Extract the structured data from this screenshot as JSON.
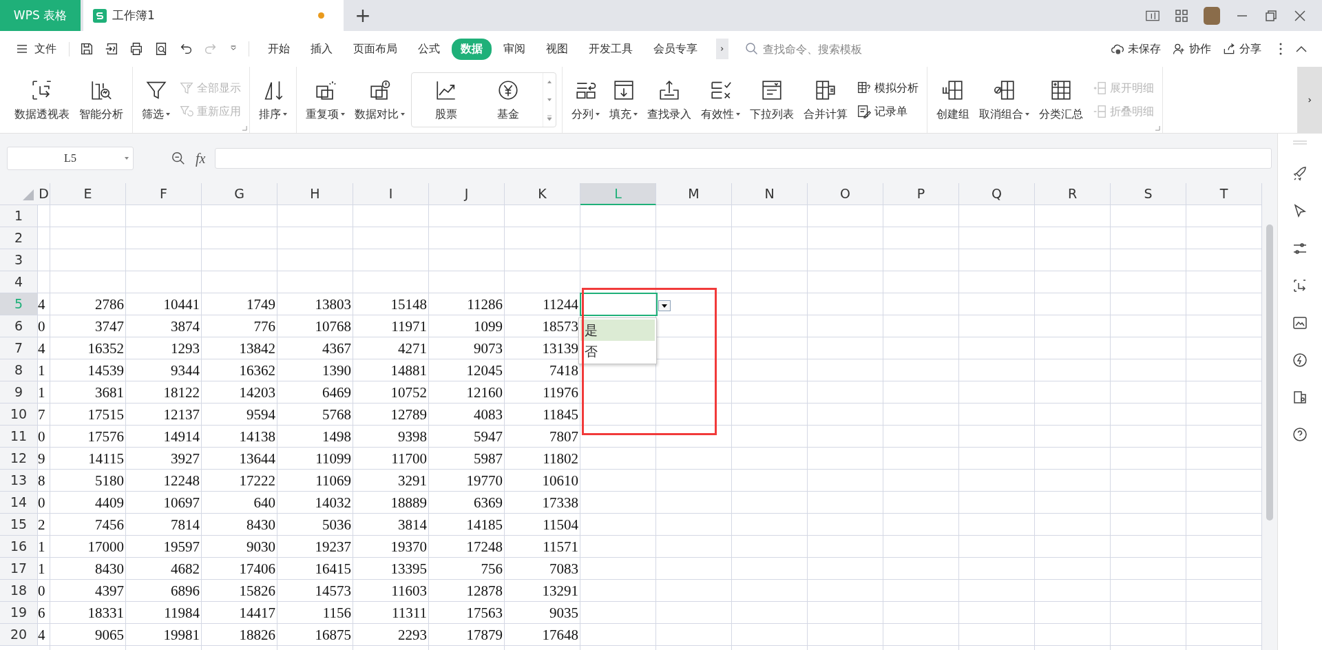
{
  "title_bar": {
    "app_button": "WPS 表格",
    "document_tab": {
      "title": "工作簿1",
      "modified": true
    },
    "new_tab": "+"
  },
  "menu": {
    "file": "文件",
    "ribbon_tabs": [
      {
        "label": "开始",
        "selected": false
      },
      {
        "label": "插入",
        "selected": false
      },
      {
        "label": "页面布局",
        "selected": false
      },
      {
        "label": "公式",
        "selected": false
      },
      {
        "label": "数据",
        "selected": true
      },
      {
        "label": "审阅",
        "selected": false
      },
      {
        "label": "视图",
        "selected": false
      },
      {
        "label": "开发工具",
        "selected": false
      },
      {
        "label": "会员专享",
        "selected": false
      }
    ],
    "search": {
      "placeholder": "查找命令、搜索模板"
    },
    "actions": [
      "未保存",
      "协作",
      "分享"
    ]
  },
  "ribbon": {
    "groups": [
      {
        "launcher": false,
        "items": [
          {
            "kind": "large",
            "label": "数据透视表",
            "dropdown": false
          },
          {
            "kind": "large",
            "label": "智能分析",
            "dropdown": false
          }
        ]
      },
      {
        "launcher": true,
        "items": [
          {
            "kind": "large",
            "label": "筛选",
            "dropdown": true
          },
          {
            "kind": "stack",
            "items": [
              {
                "label": "全部显示",
                "disabled": true
              },
              {
                "label": "重新应用",
                "disabled": true
              }
            ]
          }
        ]
      },
      {
        "launcher": false,
        "items": [
          {
            "kind": "large",
            "label": "排序",
            "dropdown": true
          }
        ]
      },
      {
        "launcher": false,
        "items": [
          {
            "kind": "large",
            "label": "重复项",
            "dropdown": true
          },
          {
            "kind": "large",
            "label": "数据对比",
            "dropdown": true
          },
          {
            "kind": "gallery",
            "items": [
              {
                "label": "股票"
              },
              {
                "label": "基金"
              }
            ]
          }
        ]
      },
      {
        "launcher": false,
        "items": [
          {
            "kind": "large",
            "label": "分列",
            "dropdown": true
          },
          {
            "kind": "large",
            "label": "填充",
            "dropdown": true
          },
          {
            "kind": "large",
            "label": "查找录入",
            "dropdown": false
          },
          {
            "kind": "large",
            "label": "有效性",
            "dropdown": true
          },
          {
            "kind": "large",
            "label": "下拉列表",
            "dropdown": false
          },
          {
            "kind": "large",
            "label": "合并计算",
            "dropdown": false
          },
          {
            "kind": "stack",
            "items": [
              {
                "label": "模拟分析",
                "disabled": false
              },
              {
                "label": "记录单",
                "disabled": false
              }
            ]
          }
        ]
      },
      {
        "launcher": true,
        "items": [
          {
            "kind": "large",
            "label": "创建组",
            "dropdown": false
          },
          {
            "kind": "large",
            "label": "取消组合",
            "dropdown": true
          },
          {
            "kind": "large",
            "label": "分类汇总",
            "dropdown": false
          },
          {
            "kind": "stack",
            "items": [
              {
                "label": "展开明细",
                "disabled": true
              },
              {
                "label": "折叠明细",
                "disabled": true
              }
            ]
          }
        ]
      }
    ]
  },
  "formula_bar": {
    "name_box": "L5",
    "fx": "fx"
  },
  "sheet": {
    "columns": [
      {
        "label": "D",
        "selected": false
      },
      {
        "label": "E",
        "selected": false
      },
      {
        "label": "F",
        "selected": false
      },
      {
        "label": "G",
        "selected": false
      },
      {
        "label": "H",
        "selected": false
      },
      {
        "label": "I",
        "selected": false
      },
      {
        "label": "J",
        "selected": false
      },
      {
        "label": "K",
        "selected": false
      },
      {
        "label": "L",
        "selected": true
      },
      {
        "label": "M",
        "selected": false
      },
      {
        "label": "N",
        "selected": false
      },
      {
        "label": "O",
        "selected": false
      },
      {
        "label": "P",
        "selected": false
      },
      {
        "label": "Q",
        "selected": false
      },
      {
        "label": "R",
        "selected": false
      },
      {
        "label": "S",
        "selected": false
      },
      {
        "label": "T",
        "selected": false
      }
    ],
    "rows": [
      {
        "label": "1",
        "selected": false
      },
      {
        "label": "2",
        "selected": false
      },
      {
        "label": "3",
        "selected": false
      },
      {
        "label": "4",
        "selected": false
      },
      {
        "label": "5",
        "selected": true,
        "cells": [
          "4",
          "2786",
          "10441",
          "1749",
          "13803",
          "15148",
          "11286",
          "11244"
        ]
      },
      {
        "label": "6",
        "selected": false,
        "cells": [
          "0",
          "3747",
          "3874",
          "776",
          "10768",
          "11971",
          "1099",
          "18573"
        ]
      },
      {
        "label": "7",
        "selected": false,
        "cells": [
          "4",
          "16352",
          "1293",
          "13842",
          "4367",
          "4271",
          "9073",
          "13139"
        ]
      },
      {
        "label": "8",
        "selected": false,
        "cells": [
          "1",
          "14539",
          "9344",
          "16362",
          "1390",
          "14881",
          "12045",
          "7418"
        ]
      },
      {
        "label": "9",
        "selected": false,
        "cells": [
          "1",
          "3681",
          "18122",
          "14203",
          "6469",
          "10752",
          "12160",
          "11976"
        ]
      },
      {
        "label": "10",
        "selected": false,
        "cells": [
          "7",
          "17515",
          "12137",
          "9594",
          "5768",
          "12789",
          "4083",
          "11845"
        ]
      },
      {
        "label": "11",
        "selected": false,
        "cells": [
          "0",
          "17576",
          "14914",
          "14138",
          "1498",
          "9398",
          "5947",
          "7807"
        ]
      },
      {
        "label": "12",
        "selected": false,
        "cells": [
          "9",
          "14115",
          "3927",
          "13644",
          "11099",
          "11700",
          "5987",
          "11802"
        ]
      },
      {
        "label": "13",
        "selected": false,
        "cells": [
          "8",
          "5180",
          "12248",
          "17222",
          "11069",
          "3291",
          "19770",
          "10610"
        ]
      },
      {
        "label": "14",
        "selected": false,
        "cells": [
          "0",
          "4409",
          "10697",
          "640",
          "14032",
          "18889",
          "6369",
          "17338"
        ]
      },
      {
        "label": "15",
        "selected": false,
        "cells": [
          "2",
          "7456",
          "7814",
          "8430",
          "5036",
          "3814",
          "14185",
          "11504"
        ]
      },
      {
        "label": "16",
        "selected": false,
        "cells": [
          "1",
          "17000",
          "19597",
          "9030",
          "19237",
          "19370",
          "17248",
          "11571"
        ]
      },
      {
        "label": "17",
        "selected": false,
        "cells": [
          "1",
          "8430",
          "4682",
          "17406",
          "16415",
          "13395",
          "756",
          "7083"
        ]
      },
      {
        "label": "18",
        "selected": false,
        "cells": [
          "0",
          "4397",
          "6896",
          "15826",
          "14573",
          "11603",
          "12878",
          "13291"
        ]
      },
      {
        "label": "19",
        "selected": false,
        "cells": [
          "6",
          "18331",
          "11984",
          "14417",
          "1156",
          "11311",
          "17563",
          "9035"
        ]
      },
      {
        "label": "20",
        "selected": false,
        "cells": [
          "4",
          "9065",
          "19981",
          "18826",
          "16875",
          "2293",
          "17879",
          "17648"
        ]
      }
    ],
    "dropdown_options": [
      {
        "label": "是",
        "selected": true
      },
      {
        "label": "否",
        "selected": false
      }
    ]
  }
}
